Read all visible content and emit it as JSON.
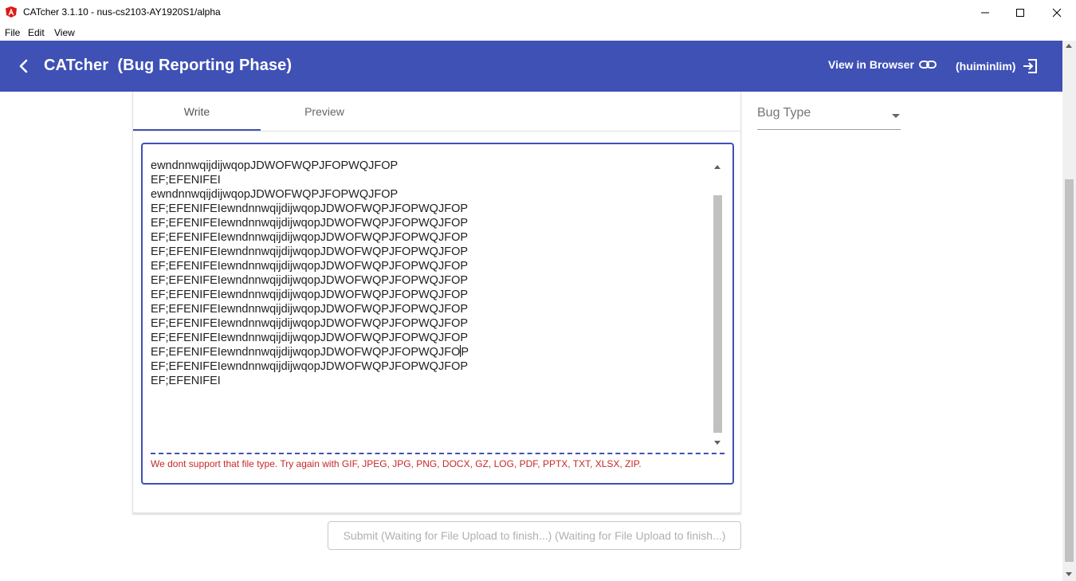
{
  "window": {
    "title": "CATcher 3.1.10 - nus-cs2103-AY1920S1/alpha"
  },
  "menu": [
    "File",
    "Edit",
    "View"
  ],
  "toolbar": {
    "title": "CATcher  (Bug Reporting Phase)",
    "view_in_browser": "View in Browser",
    "user": "(huiminlim)",
    "color": "#3f51b5"
  },
  "tabs": {
    "write": "Write",
    "preview": "Preview"
  },
  "editor": {
    "lines": [
      "ewndnnwqijdijwqopJDWOFWQPJFOPWQJFOP",
      "EF;EFENIFEI",
      "ewndnnwqijdijwqopJDWOFWQPJFOPWQJFOP",
      "EF;EFENIFEIewndnnwqijdijwqopJDWOFWQPJFOPWQJFOP",
      "EF;EFENIFEIewndnnwqijdijwqopJDWOFWQPJFOPWQJFOP",
      "EF;EFENIFEIewndnnwqijdijwqopJDWOFWQPJFOPWQJFOP",
      "EF;EFENIFEIewndnnwqijdijwqopJDWOFWQPJFOPWQJFOP",
      "EF;EFENIFEIewndnnwqijdijwqopJDWOFWQPJFOPWQJFOP",
      "EF;EFENIFEIewndnnwqijdijwqopJDWOFWQPJFOPWQJFOP",
      "EF;EFENIFEIewndnnwqijdijwqopJDWOFWQPJFOPWQJFOP",
      "EF;EFENIFEIewndnnwqijdijwqopJDWOFWQPJFOPWQJFOP",
      "EF;EFENIFEIewndnnwqijdijwqopJDWOFWQPJFOPWQJFOP",
      "EF;EFENIFEIewndnnwqijdijwqopJDWOFWQPJFOPWQJFOP",
      "EF;EFENIFEIewndnnwqijdijwqopJDWOFWQPJFOPWQJFOP",
      "EF;EFENIFEIewndnnwqijdijwqopJDWOFWQPJFOPWQJFOP",
      "EF;EFENIFEI"
    ],
    "caret_line_before": "EF;EFENIFEIewndnnwqijdijwqopJDWOFWQPJFOPWQJFO",
    "caret_line_after": "P",
    "error": "We dont support that file type. Try again with GIF, JPEG, JPG, PNG, DOCX, GZ, LOG, PDF, PPTX, TXT, XLSX, ZIP."
  },
  "submit": {
    "label": "Submit (Waiting for File Upload to finish...) (Waiting for File Upload to finish...)"
  },
  "bug_type": {
    "label": "Bug Type"
  }
}
